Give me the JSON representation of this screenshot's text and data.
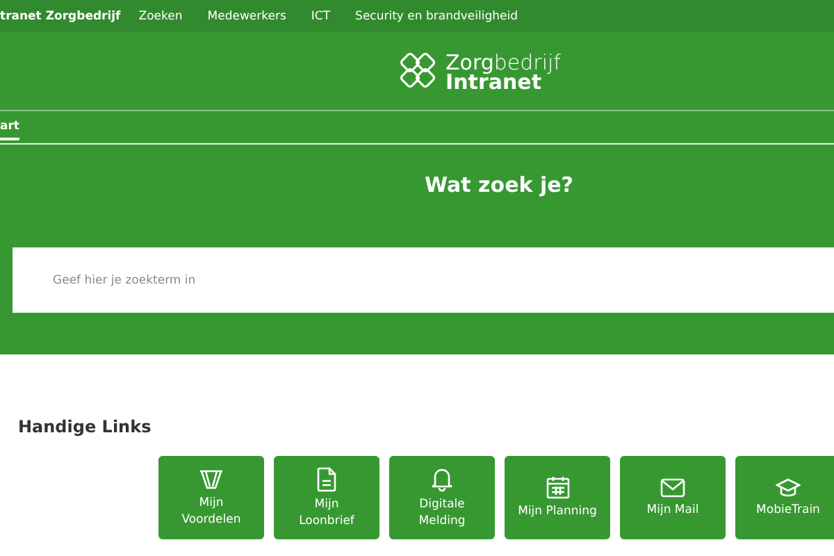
{
  "top_nav": [
    {
      "label": "tranet Zorgbedrijf",
      "kind": "brand"
    },
    {
      "label": "Zoeken",
      "kind": "link"
    },
    {
      "label": "Medewerkers",
      "kind": "link"
    },
    {
      "label": "ICT",
      "kind": "link"
    },
    {
      "label": "Security en brandveiligheid",
      "kind": "link"
    }
  ],
  "logo": {
    "line1": "**Zorg**bedrijf",
    "line2": "Intranet"
  },
  "tabs": [
    {
      "label": "art",
      "selected": true
    }
  ],
  "search": {
    "heading": "Wat zoek je?",
    "placeholder": "Geef hier je zoekterm in"
  },
  "links": {
    "title": "Handige Links",
    "items": [
      {
        "kind": "cards",
        "lines": [
          "Mijn",
          "Voordelen"
        ]
      },
      {
        "kind": "document",
        "lines": [
          "Mijn",
          "Loonbrief"
        ]
      },
      {
        "kind": "bell",
        "lines": [
          "Digitale",
          "Melding"
        ]
      },
      {
        "kind": "calendar",
        "lines": [
          "Mijn Planning"
        ]
      },
      {
        "kind": "mail",
        "lines": [
          "Mijn Mail"
        ]
      },
      {
        "kind": "cap",
        "lines": [
          "MobieTrain"
        ]
      }
    ]
  }
}
